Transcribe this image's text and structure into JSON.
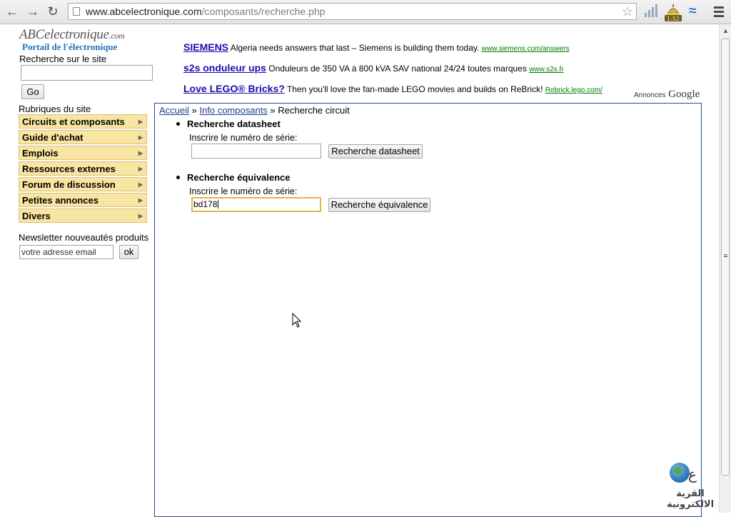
{
  "browser": {
    "url_domain": "www.abcelectronique.com",
    "url_path": "/composants/recherche.php",
    "clock_badge": "1:52"
  },
  "site": {
    "logo_main": "ABCelectronique",
    "logo_suffix": ".com",
    "logo_subtitle": "Portail de l'électronique"
  },
  "sidebar": {
    "search_label": "Recherche sur le site",
    "search_value": "",
    "go_label": "Go",
    "rubriques_label": "Rubriques du site",
    "menu": [
      {
        "label": "Circuits et composants"
      },
      {
        "label": "Guide d'achat"
      },
      {
        "label": "Emplois"
      },
      {
        "label": "Ressources externes"
      },
      {
        "label": "Forum de discussion"
      },
      {
        "label": "Petites annonces"
      },
      {
        "label": "Divers"
      }
    ],
    "newsletter_label": "Newsletter nouveautés produits",
    "newsletter_placeholder": "votre adresse email",
    "ok_label": "ok"
  },
  "ads": {
    "items": [
      {
        "title": "SIEMENS",
        "text": "Algeria needs answers that last – Siemens is building them today.",
        "url": "www.siemens.com/answers"
      },
      {
        "title": "s2s onduleur ups",
        "text": "Onduleurs de 350 VA à 800 kVA SAV national 24/24 toutes marques",
        "url": "www.s2s.fr"
      },
      {
        "title": "Love LEGO® Bricks?",
        "text": "Then you'll love the fan-made LEGO movies and builds on ReBrick!",
        "url": "Rebrick.lego.com/"
      }
    ],
    "label_annonces": "Annonces",
    "label_google": "Google"
  },
  "main": {
    "breadcrumb": {
      "home": "Accueil",
      "sep": "»",
      "section": "Info composants",
      "current": "Recherche circuit"
    },
    "datasheet": {
      "title": "Recherche datasheet",
      "field_label": "Inscrire le numéro de série:",
      "value": "",
      "button": "Recherche datasheet"
    },
    "equivalence": {
      "title": "Recherche équivalence",
      "field_label": "Inscrire le numéro de série:",
      "value": "bd178",
      "button": "Recherche équivalence"
    }
  },
  "watermark": {
    "text": "القرية الالكترونية"
  }
}
